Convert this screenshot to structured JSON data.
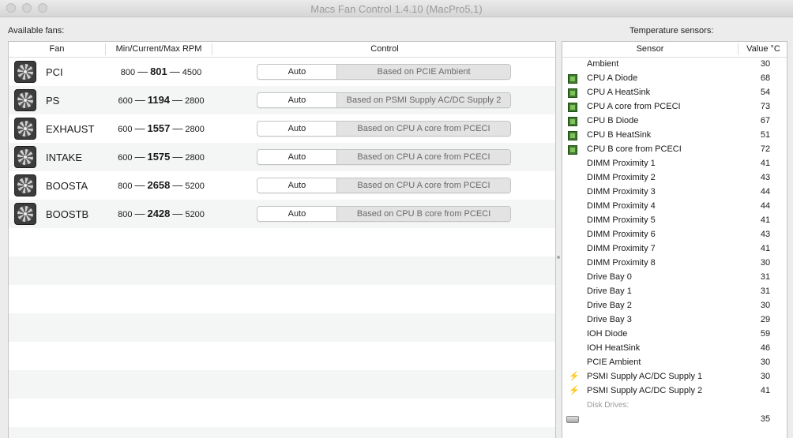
{
  "window": {
    "title": "Macs Fan Control 1.4.10 (MacPro5,1)"
  },
  "fans_section": {
    "label": "Available fans:",
    "headers": {
      "fan": "Fan",
      "rpm": "Min/Current/Max RPM",
      "control": "Control"
    },
    "fans": [
      {
        "name": "PCI",
        "min": "800",
        "current": "801",
        "max": "4500",
        "mode": "Auto",
        "based_on": "Based on PCIE Ambient"
      },
      {
        "name": "PS",
        "min": "600",
        "current": "1194",
        "max": "2800",
        "mode": "Auto",
        "based_on": "Based on PSMI Supply AC/DC Supply 2"
      },
      {
        "name": "EXHAUST",
        "min": "600",
        "current": "1557",
        "max": "2800",
        "mode": "Auto",
        "based_on": "Based on CPU A core from PCECI"
      },
      {
        "name": "INTAKE",
        "min": "600",
        "current": "1575",
        "max": "2800",
        "mode": "Auto",
        "based_on": "Based on CPU A core from PCECI"
      },
      {
        "name": "BOOSTA",
        "min": "800",
        "current": "2658",
        "max": "5200",
        "mode": "Auto",
        "based_on": "Based on CPU A core from PCECI"
      },
      {
        "name": "BOOSTB",
        "min": "800",
        "current": "2428",
        "max": "5200",
        "mode": "Auto",
        "based_on": "Based on CPU B core from PCECI"
      }
    ],
    "rpm_separator": "—"
  },
  "sensors_section": {
    "label": "Temperature sensors:",
    "headers": {
      "sensor": "Sensor",
      "value": "Value °C"
    },
    "sensors": [
      {
        "name": "Ambient",
        "value": "30",
        "icon": ""
      },
      {
        "name": "CPU A Diode",
        "value": "68",
        "icon": "cpu-chip-icon"
      },
      {
        "name": "CPU A HeatSink",
        "value": "54",
        "icon": "cpu-chip-icon"
      },
      {
        "name": "CPU A core from PCECI",
        "value": "73",
        "icon": "cpu-chip-icon"
      },
      {
        "name": "CPU B Diode",
        "value": "67",
        "icon": "cpu-chip-icon"
      },
      {
        "name": "CPU B HeatSink",
        "value": "51",
        "icon": "cpu-chip-icon"
      },
      {
        "name": "CPU B core from PCECI",
        "value": "72",
        "icon": "cpu-chip-icon"
      },
      {
        "name": "DIMM Proximity 1",
        "value": "41",
        "icon": ""
      },
      {
        "name": "DIMM Proximity 2",
        "value": "43",
        "icon": ""
      },
      {
        "name": "DIMM Proximity 3",
        "value": "44",
        "icon": ""
      },
      {
        "name": "DIMM Proximity 4",
        "value": "44",
        "icon": ""
      },
      {
        "name": "DIMM Proximity 5",
        "value": "41",
        "icon": ""
      },
      {
        "name": "DIMM Proximity 6",
        "value": "43",
        "icon": ""
      },
      {
        "name": "DIMM Proximity 7",
        "value": "41",
        "icon": ""
      },
      {
        "name": "DIMM Proximity 8",
        "value": "30",
        "icon": ""
      },
      {
        "name": "Drive Bay 0",
        "value": "31",
        "icon": ""
      },
      {
        "name": "Drive Bay 1",
        "value": "31",
        "icon": ""
      },
      {
        "name": "Drive Bay 2",
        "value": "30",
        "icon": ""
      },
      {
        "name": "Drive Bay 3",
        "value": "29",
        "icon": ""
      },
      {
        "name": "IOH Diode",
        "value": "59",
        "icon": ""
      },
      {
        "name": "IOH HeatSink",
        "value": "46",
        "icon": ""
      },
      {
        "name": "PCIE Ambient",
        "value": "30",
        "icon": ""
      },
      {
        "name": "PSMI Supply AC/DC Supply 1",
        "value": "30",
        "icon": "power-bolt-icon"
      },
      {
        "name": "PSMI Supply AC/DC Supply 2",
        "value": "41",
        "icon": "power-bolt-icon"
      }
    ],
    "disk_category": "Disk Drives:",
    "disks": [
      {
        "name": "",
        "value": "35",
        "icon": "hard-disk-icon"
      }
    ]
  }
}
